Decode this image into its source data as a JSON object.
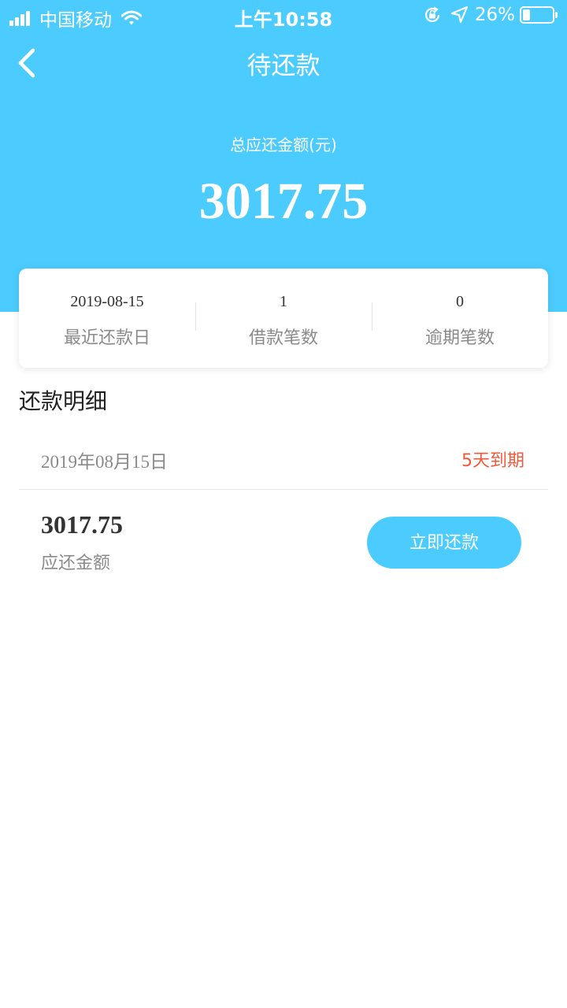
{
  "status_bar": {
    "carrier": "中国移动",
    "time": "上午10:58",
    "battery": "26%",
    "battery_level": 0.26
  },
  "nav": {
    "title": "待还款"
  },
  "total": {
    "label": "总应还金额(元)",
    "amount": "3017.75"
  },
  "summary": {
    "items": [
      {
        "value": "2019-08-15",
        "label": "最近还款日"
      },
      {
        "value": "1",
        "label": "借款笔数"
      },
      {
        "value": "0",
        "label": "逾期笔数"
      }
    ]
  },
  "details": {
    "title": "还款明细",
    "date": "2019年08月15日",
    "due": "5天到期",
    "amount": "3017.75",
    "amount_label": "应还金额",
    "pay_button": "立即还款"
  },
  "colors": {
    "primary": "#4ccbff",
    "warning": "#f05a3a"
  }
}
